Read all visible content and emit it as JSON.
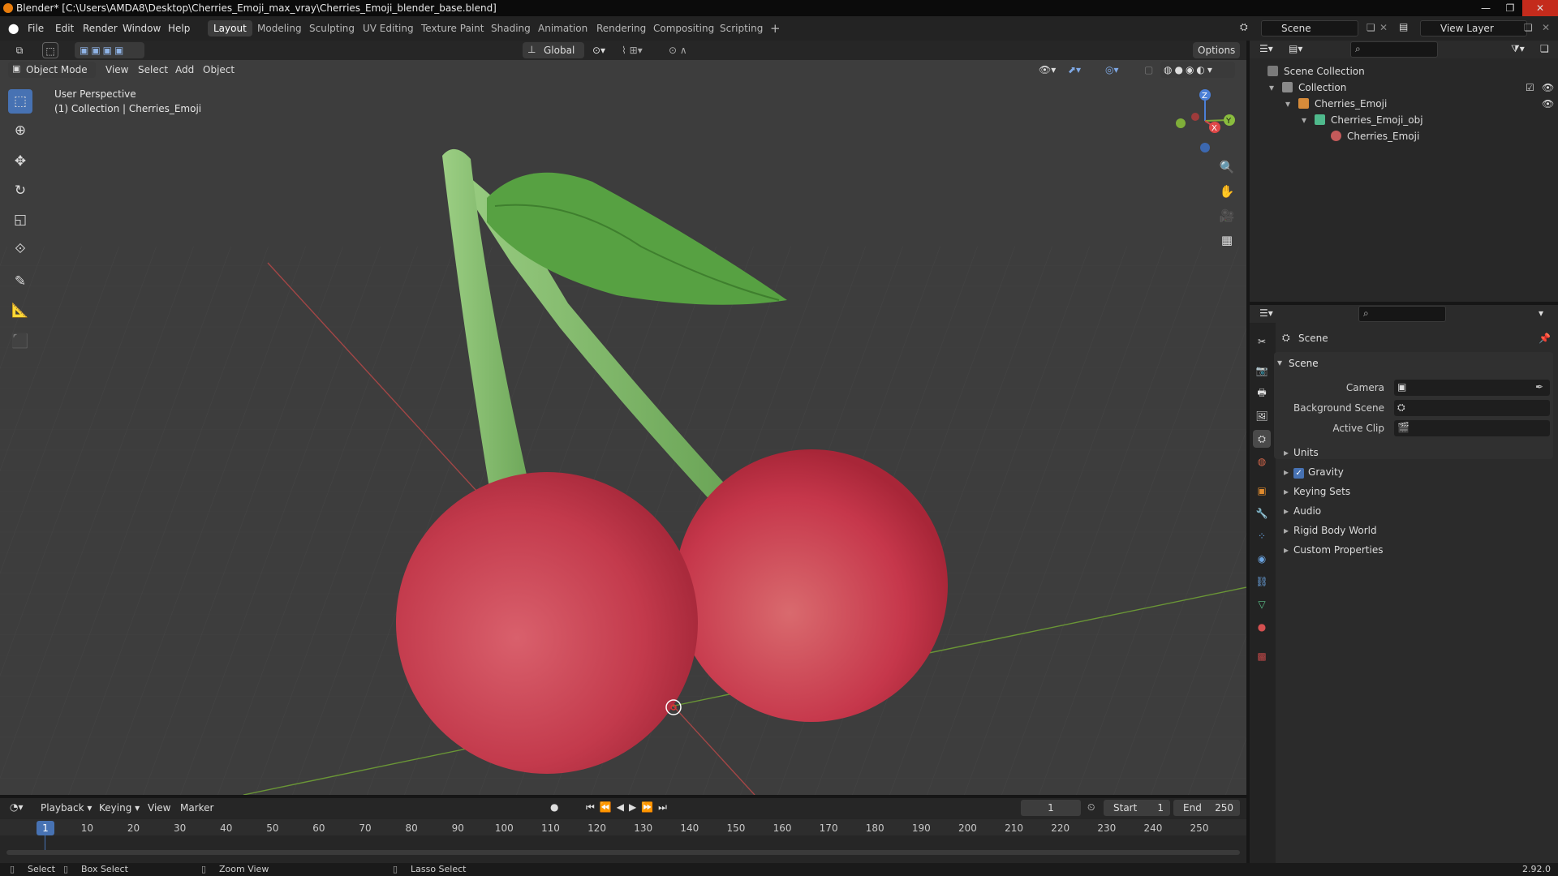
{
  "window": {
    "title": "Blender* [C:\\Users\\AMDA8\\Desktop\\Cherries_Emoji_max_vray\\Cherries_Emoji_blender_base.blend]"
  },
  "menu": [
    "File",
    "Edit",
    "Render",
    "Window",
    "Help"
  ],
  "workspaces": [
    "Layout",
    "Modeling",
    "Sculpting",
    "UV Editing",
    "Texture Paint",
    "Shading",
    "Animation",
    "Rendering",
    "Compositing",
    "Scripting"
  ],
  "active_workspace": "Layout",
  "scene_field": "Scene",
  "view_layer_field": "View Layer",
  "viewport": {
    "transform_orientation": "Global",
    "options_label": "Options",
    "mode": "Object Mode",
    "header_menus": [
      "View",
      "Select",
      "Add",
      "Object"
    ],
    "overlay_title": "User Perspective",
    "overlay_subtitle": "(1) Collection | Cherries_Emoji",
    "gizmo_axes": {
      "x": "X",
      "y": "Y",
      "z": "Z"
    },
    "colors": {
      "background": "#3c3c3c",
      "cherry": "#c8344a",
      "stem": "#7fb86a",
      "leaf": "#4f9a3d",
      "axis_x": "#b34040",
      "axis_y": "#6d9a2f"
    }
  },
  "toolbar_icons": [
    "select-box-icon",
    "cursor-icon",
    "move-icon",
    "rotate-icon",
    "scale-icon",
    "transform-icon",
    "annotate-icon",
    "measure-icon",
    "add-cube-icon"
  ],
  "outliner": {
    "root": "Scene Collection",
    "rows": [
      {
        "label": "Collection",
        "indent": 1
      },
      {
        "label": "Cherries_Emoji",
        "indent": 2
      },
      {
        "label": "Cherries_Emoji_obj",
        "indent": 3
      },
      {
        "label": "Cherries_Emoji",
        "indent": 4
      }
    ]
  },
  "properties": {
    "context": "Scene",
    "panel_title": "Scene",
    "fields": [
      {
        "label": "Camera"
      },
      {
        "label": "Background Scene"
      },
      {
        "label": "Active Clip"
      }
    ],
    "subpanels": [
      "Units",
      "Gravity",
      "Keying Sets",
      "Audio",
      "Rigid Body World",
      "Custom Properties"
    ],
    "gravity_checked": true
  },
  "timeline": {
    "menus": [
      "Playback",
      "Keying",
      "View",
      "Marker"
    ],
    "current_frame": "1",
    "start_label": "Start",
    "start_value": "1",
    "end_label": "End",
    "end_value": "250",
    "frame_ticks": [
      "1",
      "10",
      "20",
      "30",
      "40",
      "50",
      "60",
      "70",
      "80",
      "90",
      "100",
      "110",
      "120",
      "130",
      "140",
      "150",
      "160",
      "170",
      "180",
      "190",
      "200",
      "210",
      "220",
      "230",
      "240",
      "250"
    ]
  },
  "statusbar": {
    "items": [
      "Select",
      "Box Select",
      "Zoom View",
      "Lasso Select"
    ],
    "version": "2.92.0"
  }
}
